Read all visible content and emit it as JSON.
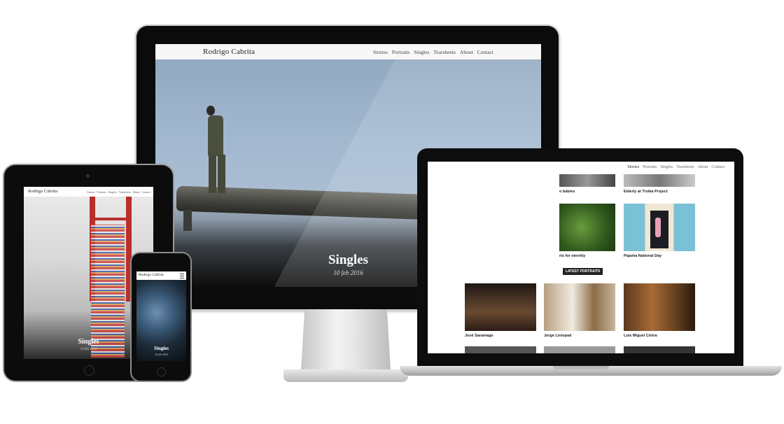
{
  "site": {
    "logo": "Rodrigo Cabrita",
    "nav": [
      "Stories",
      "Portraits",
      "Singles",
      "Tearsheets",
      "About",
      "Contact"
    ]
  },
  "hero": {
    "title": "Singles",
    "date": "10 feb 2016"
  },
  "laptop": {
    "captions_top": [
      "o babies",
      "Elderly at Troika Project"
    ],
    "captions_mid": [
      "rts for eternity",
      "Pajama National Day"
    ],
    "section_label": "LATEST PORTRAITS",
    "portrait_captions": [
      "José Saramago",
      "Jorge Listopad",
      "Luís Miguel Cintra"
    ]
  },
  "colors": {
    "bridge_red": "#b9302b",
    "header_bg": "#f7f7f7",
    "badge_bg": "#222222"
  }
}
